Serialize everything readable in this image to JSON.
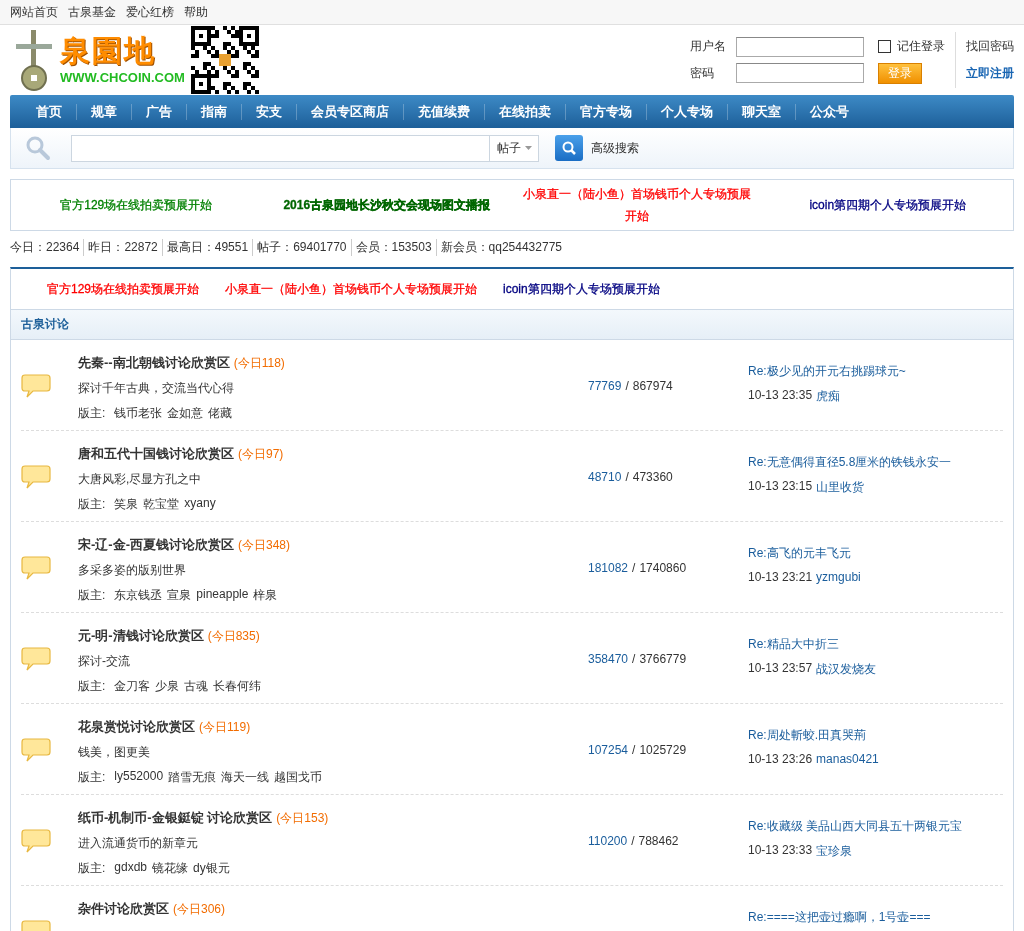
{
  "top_links": [
    "网站首页",
    "古泉基金",
    "爱心红榜",
    "帮助"
  ],
  "logo": {
    "title": "泉園地",
    "url": "WWW.CHCOIN.COM"
  },
  "login": {
    "username_label": "用户名",
    "password_label": "密码",
    "remember": {
      "label": "记住登录",
      "checked": false
    },
    "submit": "登录",
    "forgot": "找回密码",
    "register": "立即注册"
  },
  "nav": [
    "首页",
    "规章",
    "广告",
    "指南",
    "安支",
    "会员专区商店",
    "充值续费",
    "在线拍卖",
    "官方专场",
    "个人专场",
    "聊天室",
    "公众号"
  ],
  "search": {
    "type": "帖子",
    "advanced": "高级搜索"
  },
  "ads": [
    {
      "text": "官方129场在线拍卖预展开始",
      "color": "#008000",
      "bold": false
    },
    {
      "text": "2016古泉园地长沙秋交会现场图文播报",
      "color": "#006600",
      "bold": true
    },
    {
      "text": "小泉直一（陆小鱼）首场钱币个人专场预展开始",
      "color": "#ff0000",
      "bold": false
    },
    {
      "text": "icoin第四期个人专场预展开始",
      "color": "#000080",
      "bold": false
    }
  ],
  "stats": [
    "今日：22364",
    "昨日：22872",
    "最高日：49551",
    "帖子：69401770",
    "会员：153503",
    "新会员：qq254432775"
  ],
  "announcements": [
    {
      "text": "官方129场在线拍卖预展开始",
      "color": "#ff0000"
    },
    {
      "text": "小泉直一（陆小鱼）首场钱币个人专场预展开始",
      "color": "#ff0000"
    },
    {
      "text": "icoin第四期个人专场预展开始",
      "color": "#000080"
    }
  ],
  "category": "古泉讨论",
  "forums": [
    {
      "name": "先秦--南北朝钱讨论欣赏区",
      "today": "(今日118)",
      "desc": "探讨千年古典，交流当代心得",
      "moderators_label": "版主:",
      "moderators": [
        "钱币老张",
        "金如意",
        "佬藏"
      ],
      "threads": "77769",
      "sep": "/",
      "posts": "867974",
      "last_title": "Re:极少见的开元右挑踢球元~",
      "last_time": "10-13 23:35",
      "last_user": "虎痴"
    },
    {
      "name": "唐和五代十国钱讨论欣赏区",
      "today": "(今日97)",
      "desc": "大唐风彩,尽显方孔之中",
      "moderators_label": "版主:",
      "moderators": [
        "笑泉",
        "乾宝堂",
        "xyany"
      ],
      "threads": "48710",
      "sep": "/",
      "posts": "473360",
      "last_title": "Re:无意偶得直径5.8厘米的铁钱永安一",
      "last_time": "10-13 23:15",
      "last_user": "山里收货"
    },
    {
      "name": "宋-辽-金-西夏钱讨论欣赏区",
      "today": "(今日348)",
      "desc": "多采多姿的版别世界",
      "moderators_label": "版主:",
      "moderators": [
        "东京钱丞",
        "宣泉",
        "pineapple",
        "梓泉"
      ],
      "threads": "181082",
      "sep": "/",
      "posts": "1740860",
      "last_title": "Re:高飞的元丰飞元",
      "last_time": "10-13 23:21",
      "last_user": "yzmgubi"
    },
    {
      "name": "元-明-清钱讨论欣赏区",
      "today": "(今日835)",
      "desc": "探讨-交流",
      "moderators_label": "版主:",
      "moderators": [
        "金刀客",
        "少泉",
        "古魂",
        "长春何纬"
      ],
      "threads": "358470",
      "sep": "/",
      "posts": "3766779",
      "last_title": "Re:精品大中折三",
      "last_time": "10-13 23:57",
      "last_user": "战汉发烧友"
    },
    {
      "name": "花泉赏悦讨论欣赏区",
      "today": "(今日119)",
      "desc": "钱美，图更美",
      "moderators_label": "版主:",
      "moderators": [
        "ly552000",
        "踏雪无痕",
        "海天一线",
        "越国戈币"
      ],
      "threads": "107254",
      "sep": "/",
      "posts": "1025729",
      "last_title": "Re:周处斬蛟.田真哭荊",
      "last_time": "10-13 23:26",
      "last_user": "manas0421"
    },
    {
      "name": "纸币-机制币-金银鋌锭 讨论欣赏区",
      "today": "(今日153)",
      "desc": "进入流通货币的新章元",
      "moderators_label": "版主:",
      "moderators": [
        "gdxdb",
        "镜花缘",
        "dy银元"
      ],
      "threads": "110200",
      "sep": "/",
      "posts": "788462",
      "last_title": "Re:收藏级 美品山西大同县五十两银元宝",
      "last_time": "10-13 23:33",
      "last_user": "宝珍泉"
    },
    {
      "name": "杂件讨论欣赏区",
      "today": "(今日306)",
      "last_title": "Re:====这把壶过瘾啊，1号壶==="
    }
  ]
}
